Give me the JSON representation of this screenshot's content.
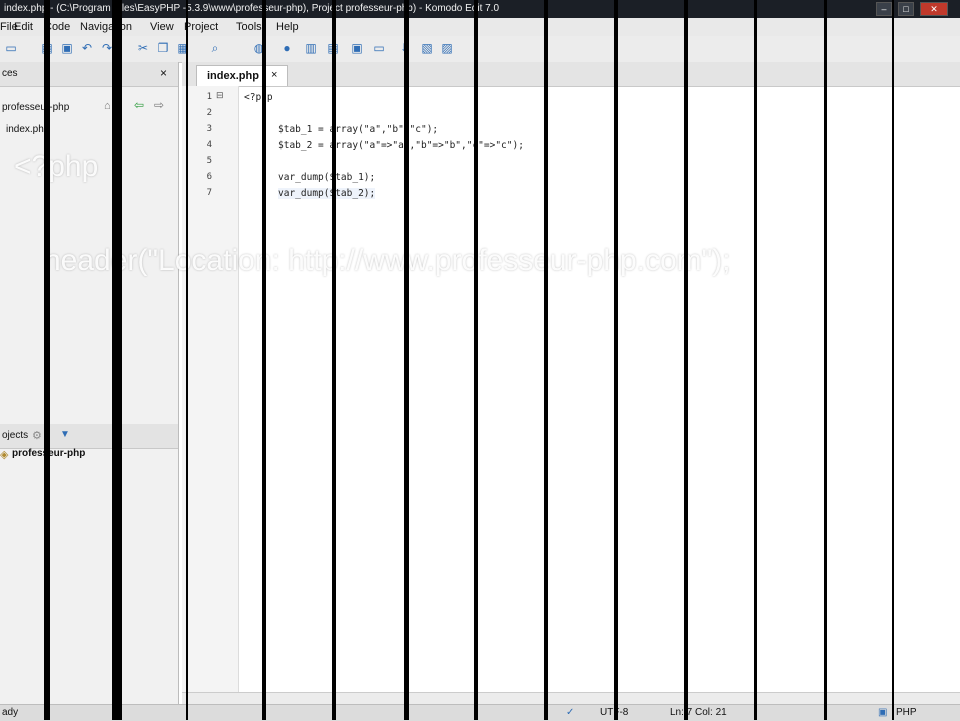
{
  "window": {
    "title": "index.php - (C:\\Program   Files\\EasyPHP   -5.3.9\\www\\professeur-php), Project professeur-php) - Komodo Edit 7.0",
    "minimize": "–",
    "maximize": "□",
    "close": "✕"
  },
  "menu": {
    "items": [
      "File",
      "Edit",
      "Code",
      "Navigation",
      "View",
      "Project",
      "Tools",
      "Help"
    ]
  },
  "toolbar": {
    "icons": [
      "new-file-icon",
      "open-folder-icon",
      "save-icon",
      "undo-icon",
      "redo-icon",
      "cut-icon",
      "copy-icon",
      "paste-icon",
      "search-icon",
      "globe-icon",
      "toggle-pane-icon",
      "toggle-bottom-icon",
      "debug-icon",
      "run-icon",
      "macro-icon",
      "toolbox-icon"
    ]
  },
  "left_pane": {
    "places_header": "ces",
    "places_close": "×",
    "project_root": "professeur-php",
    "file_item": "index.php",
    "projects_header": "ojects",
    "projects_item": "professeur-php"
  },
  "editor": {
    "tab_label": "index.php",
    "tab_close": "×",
    "lines": [
      {
        "num": "1",
        "text": "<?php"
      },
      {
        "num": "2",
        "text": ""
      },
      {
        "num": "3",
        "text": "$tab_1 = array(\"a\",\"b\",\"c\");"
      },
      {
        "num": "4",
        "text": "$tab_2 = array(\"a\"=>\"a\",\"b\"=>\"b\",\"c\"=>\"c\");"
      },
      {
        "num": "5",
        "text": ""
      },
      {
        "num": "6",
        "text": "var_dump($tab_1);"
      },
      {
        "num": "7",
        "text": "var_dump($tab_2);"
      }
    ]
  },
  "overlay": {
    "php_open": "<?php",
    "header_line": "header(\"Location: http://www.professeur-php.com\");"
  },
  "status": {
    "left": "ady",
    "encoding": "UTF-8",
    "position": "Ln: 7 Col: 21",
    "language": "PHP"
  },
  "colors": {
    "titlebar": "#1b1f26",
    "accent": "#2f6db5"
  }
}
